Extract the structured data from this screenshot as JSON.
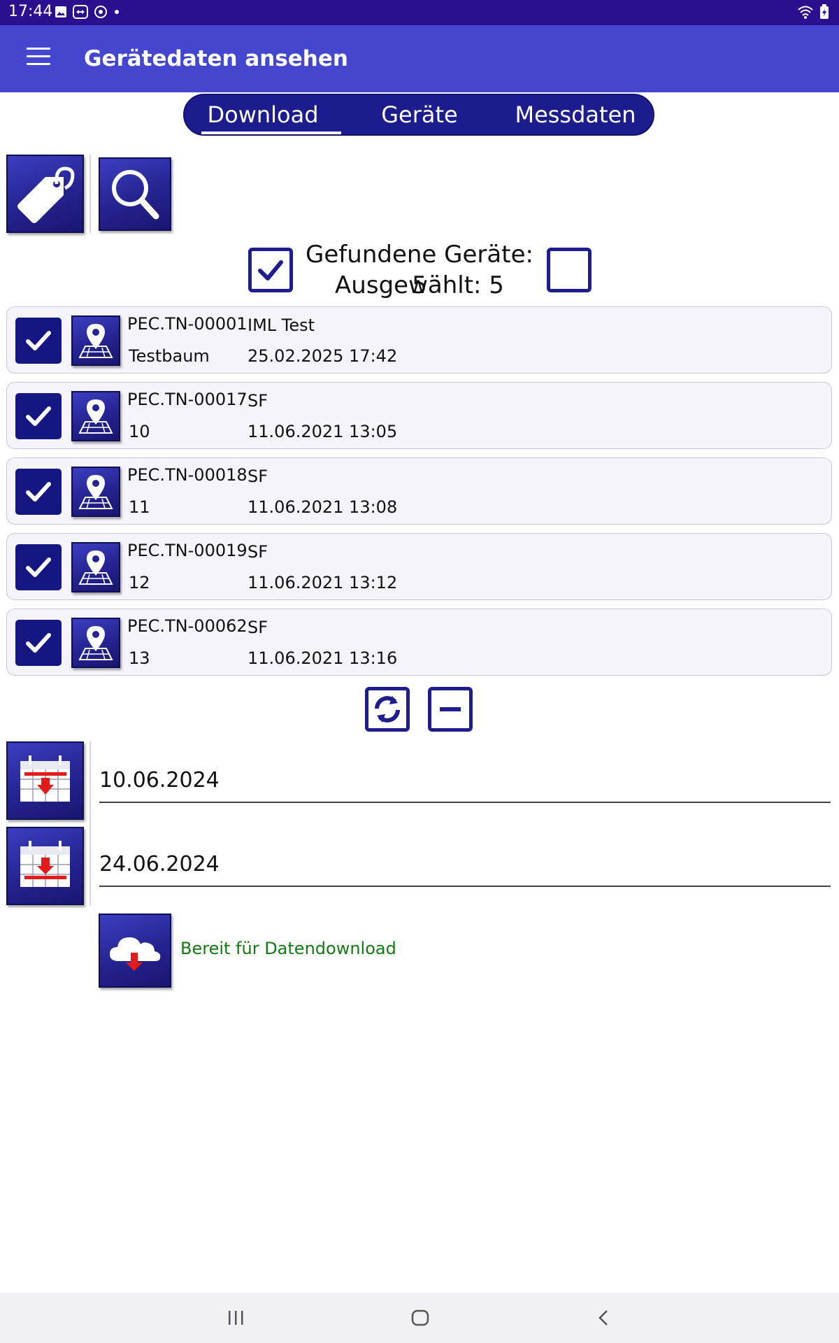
{
  "status_bar": {
    "time": "17:44",
    "icons": [
      "image-icon",
      "teamviewer-icon",
      "sync-icon",
      "dot-icon"
    ],
    "right_icons": [
      "wifi-icon",
      "battery-icon"
    ]
  },
  "app_bar": {
    "title": "Gerätedaten ansehen",
    "menu_icon": "menu-icon"
  },
  "tabs": [
    {
      "label": "Download",
      "active": true
    },
    {
      "label": "Geräte",
      "active": false
    },
    {
      "label": "Messdaten",
      "active": false
    }
  ],
  "toolbar": {
    "tag_icon": "tag-icon",
    "search_icon": "search-icon"
  },
  "summary": {
    "found_label": "Gefundene Geräte: 5",
    "selected_label": "Ausgewählt: 5",
    "select_all_checked": true,
    "deselect_checked": false
  },
  "devices": [
    {
      "id": "PEC.TN-00001",
      "type": "IML Test",
      "name": "Testbaum",
      "datetime": "25.02.2025 17:42",
      "checked": true
    },
    {
      "id": "PEC.TN-00017",
      "type": "SF",
      "name": "10",
      "datetime": "11.06.2021 13:05",
      "checked": true
    },
    {
      "id": "PEC.TN-00018",
      "type": "SF",
      "name": "11",
      "datetime": "11.06.2021 13:08",
      "checked": true
    },
    {
      "id": "PEC.TN-00019",
      "type": "SF",
      "name": "12",
      "datetime": "11.06.2021 13:12",
      "checked": true
    },
    {
      "id": "PEC.TN-00062",
      "type": "SF",
      "name": "13",
      "datetime": "11.06.2021 13:16",
      "checked": true
    }
  ],
  "actions": {
    "refresh_icon": "refresh-icon",
    "remove_icon": "minus-icon"
  },
  "date_range": {
    "start": "10.06.2024",
    "end": "24.06.2024"
  },
  "download": {
    "icon": "cloud-download-icon",
    "status": "Bereit für Datendownload",
    "status_color": "#137a13"
  },
  "colors": {
    "status_bar": "#2a0f8f",
    "app_bar": "#4546cf",
    "primary_dark": "#1d1c8e",
    "accent_red": "#e21b1b"
  },
  "nav_bar": {
    "icons": [
      "recent-apps-icon",
      "home-icon",
      "back-icon"
    ]
  }
}
